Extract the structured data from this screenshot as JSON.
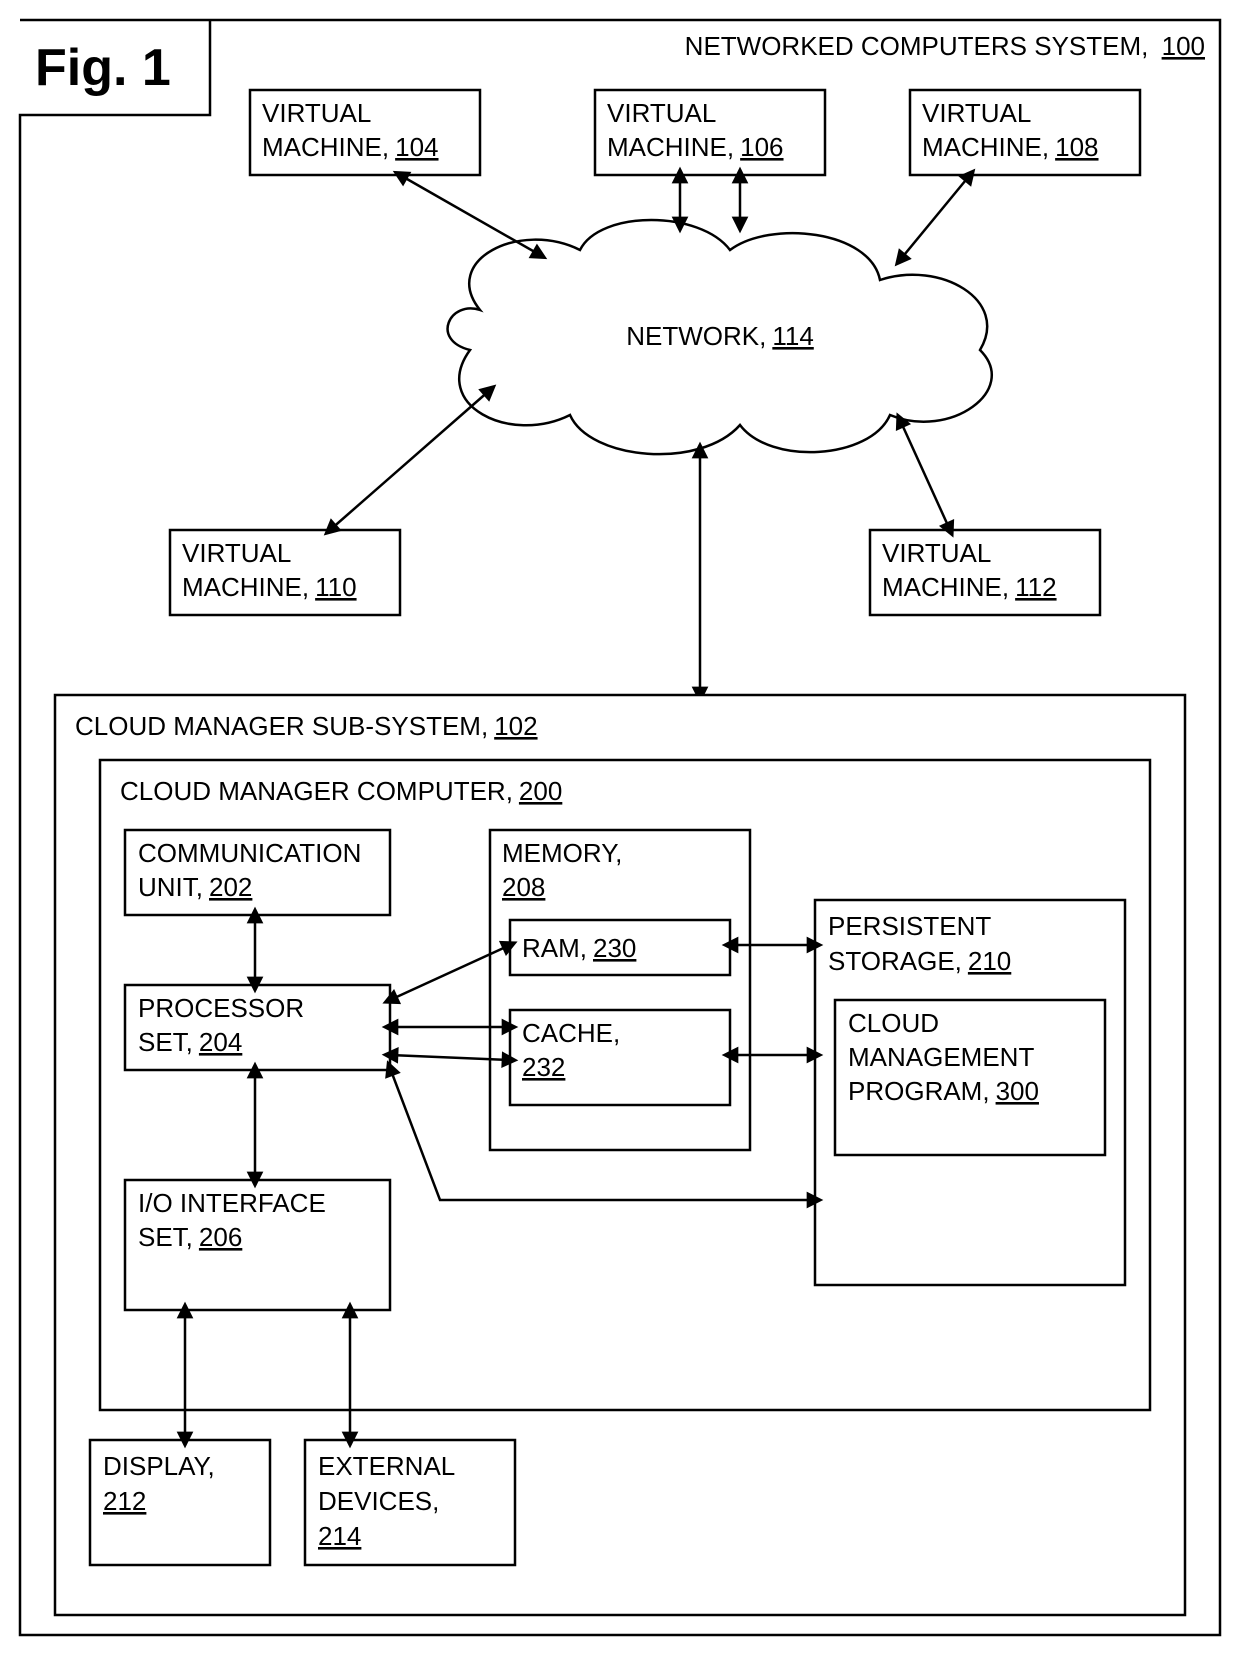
{
  "figure": {
    "label": "Fig. 1"
  },
  "system": {
    "label": "NETWORKED COMPUTERS SYSTEM,",
    "ref": "100"
  },
  "vm104": {
    "l1": "VIRTUAL",
    "l2": "MACHINE,",
    "ref": "104"
  },
  "vm106": {
    "l1": "VIRTUAL",
    "l2": "MACHINE,",
    "ref": "106"
  },
  "vm108": {
    "l1": "VIRTUAL",
    "l2": "MACHINE,",
    "ref": "108"
  },
  "vm110": {
    "l1": "VIRTUAL",
    "l2": "MACHINE,",
    "ref": "110"
  },
  "vm112": {
    "l1": "VIRTUAL",
    "l2": "MACHINE,",
    "ref": "112"
  },
  "network": {
    "label": "NETWORK,",
    "ref": "114"
  },
  "subsystem": {
    "label": "CLOUD MANAGER SUB-SYSTEM,",
    "ref": "102"
  },
  "computer": {
    "label": "CLOUD MANAGER COMPUTER,",
    "ref": "200"
  },
  "comm": {
    "l1": "COMMUNICATION",
    "l2": "UNIT,",
    "ref": "202"
  },
  "proc": {
    "l1": "PROCESSOR",
    "l2": "SET,",
    "ref": "204"
  },
  "io": {
    "l1": "I/O INTERFACE",
    "l2": "SET,",
    "ref": "206"
  },
  "memory": {
    "label": "MEMORY,",
    "ref": "208"
  },
  "ram": {
    "label": "RAM,",
    "ref": "230"
  },
  "cache": {
    "l1": "CACHE,",
    "ref": "232"
  },
  "persist": {
    "l1": "PERSISTENT",
    "l2": "STORAGE,",
    "ref": "210"
  },
  "prog": {
    "l1": "CLOUD",
    "l2": "MANAGEMENT",
    "l3": "PROGRAM,",
    "ref": "300"
  },
  "display": {
    "l1": "DISPLAY,",
    "ref": "212"
  },
  "ext": {
    "l1": "EXTERNAL",
    "l2": "DEVICES,",
    "ref": "214"
  }
}
